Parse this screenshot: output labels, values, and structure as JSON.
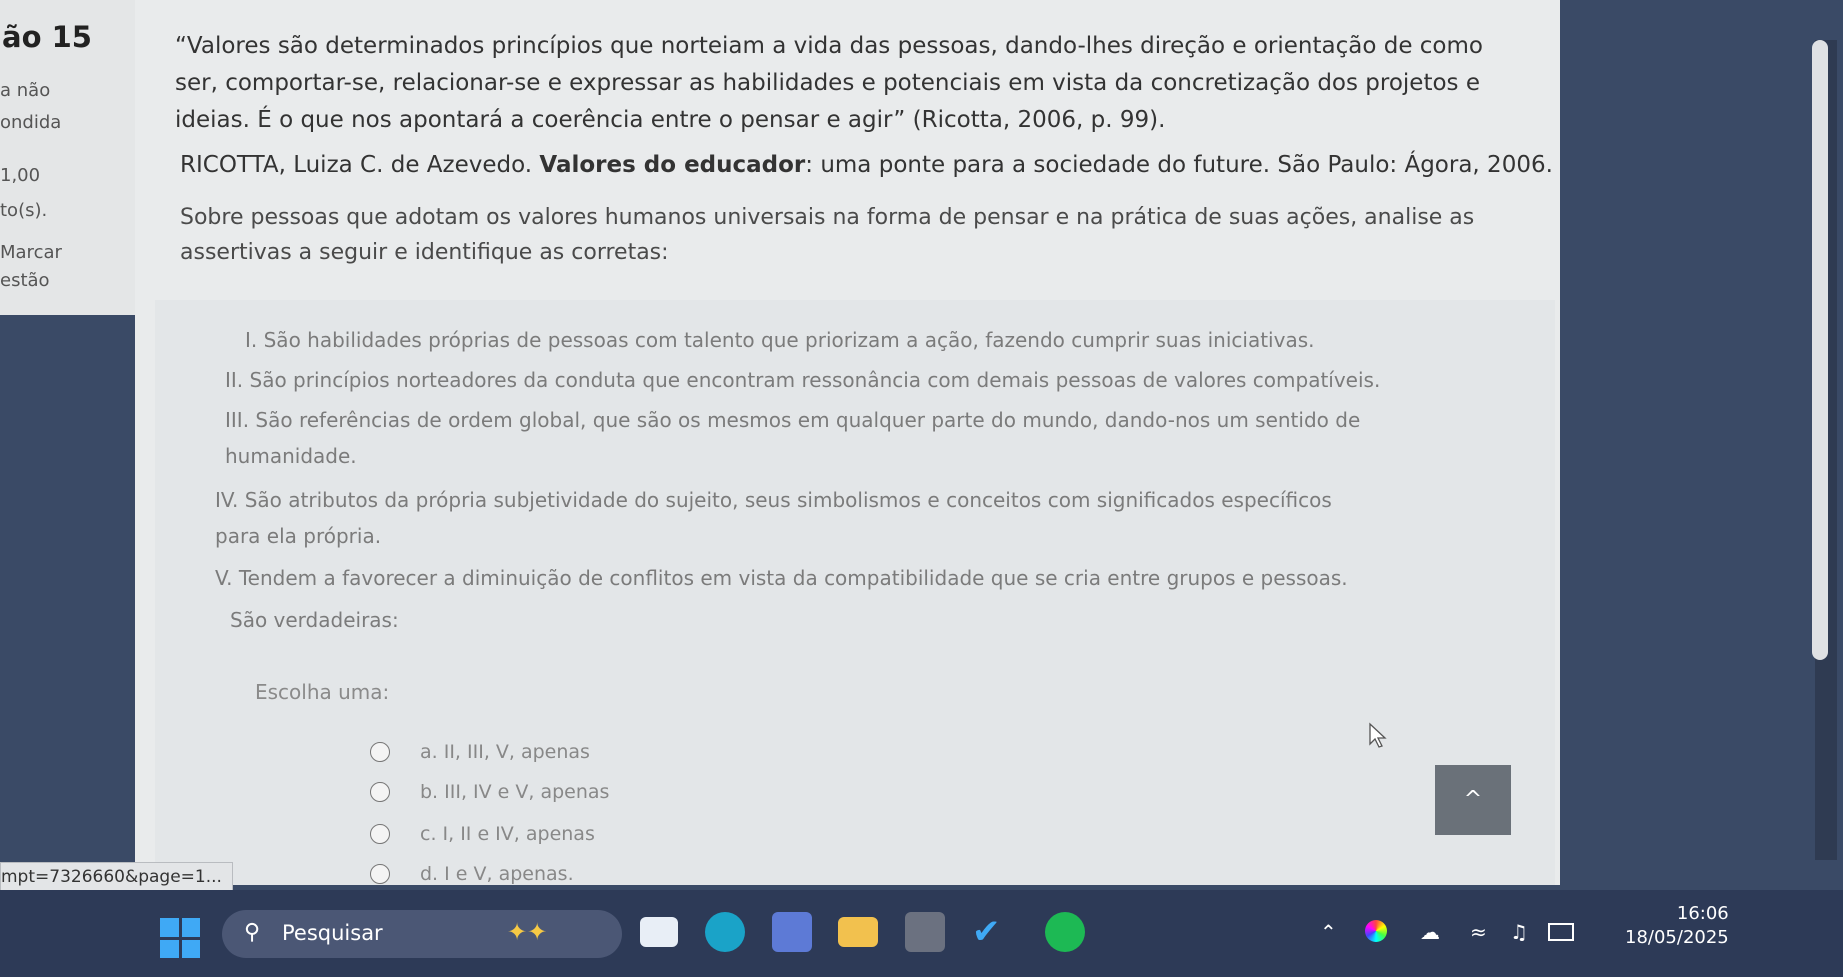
{
  "sidebar": {
    "question_number": "ão 15",
    "lines": [
      "a não",
      "ondida",
      "1,00",
      "to(s).",
      "Marcar",
      "estão"
    ]
  },
  "question": {
    "stem_line1": "“Valores são determinados princípios que norteiam a vida das pessoas, dando-lhes direção e orientação de como",
    "stem_line2": "ser, comportar-se, relacionar-se e expressar as habilidades e potenciais em vista da concretização dos projetos e",
    "stem_line3": "ideias. É o que nos apontará a coerência entre o pensar e agir” (Ricotta, 2006, p. 99).",
    "reference_author": "RICOTTA, Luiza C. de Azevedo. ",
    "reference_title": "Valores do educador",
    "reference_rest": ": uma ponte para a sociedade do future. São Paulo: Ágora, 2006.",
    "instruction_line1": "Sobre pessoas que adotam os valores humanos universais na forma de pensar e na prática de suas ações, analise as",
    "instruction_line2": "assertivas a seguir e identifique as corretas:",
    "assertions": [
      "I. São habilidades próprias de pessoas com talento que priorizam a ação, fazendo cumprir suas iniciativas.",
      "II. São princípios norteadores da conduta que encontram ressonância com demais pessoas de valores compatíveis.",
      "III. São referências de ordem global, que são os mesmos em qualquer parte do mundo, dando-nos um sentido de",
      "humanidade.",
      "IV. São atributos da própria subjetividade do sujeito, seus simbolismos e conceitos com significados específicos",
      "para ela própria.",
      "V. Tendem a favorecer a diminuição de conflitos em vista da compatibilidade que se cria entre grupos e pessoas."
    ],
    "true_label": "São verdadeiras:",
    "choose_label": "Escolha uma:",
    "options": [
      "a. II, III, V, apenas",
      "b. III, IV e V, apenas",
      "c. I, II e IV, apenas",
      "d. I e V, apenas."
    ]
  },
  "scroll_top_glyph": "^",
  "status_url": "mpt=7326660&page=1...",
  "taskbar": {
    "search_placeholder": "Pesquisar",
    "time": "16:06",
    "date": "18/05/2025",
    "icons": [
      "windows-icon",
      "search-icon",
      "file-explorer-icon",
      "edge-icon",
      "copilot-icon",
      "folder-icon",
      "calculator-icon",
      "todo-icon",
      "spotify-icon"
    ],
    "tray_icons": [
      "chevron-up-icon",
      "color-wheel-icon",
      "cloud-icon",
      "wifi-icon",
      "volume-icon",
      "battery-icon"
    ]
  }
}
